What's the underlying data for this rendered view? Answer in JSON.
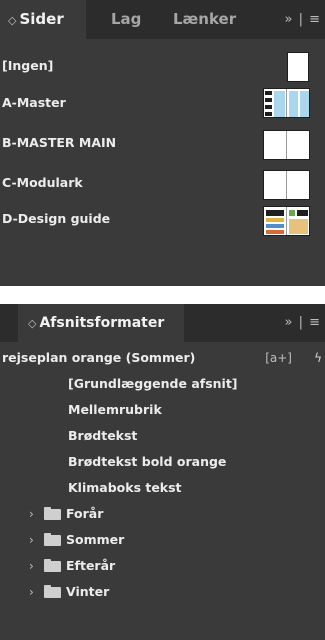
{
  "pages_panel": {
    "tabs": [
      {
        "label": "Sider",
        "active": true
      },
      {
        "label": "Lag",
        "active": false
      },
      {
        "label": "Lænker",
        "active": false
      }
    ],
    "overflow_glyph": "»",
    "menu_glyph": "|  ≡",
    "collapse_glyph": "◇",
    "masters": [
      {
        "label": "[Ingen]",
        "thumb": "single-blank"
      },
      {
        "label": "A-Master",
        "thumb": "spread-grid"
      },
      {
        "label": "B-MASTER MAIN",
        "thumb": "spread-blank"
      },
      {
        "label": "C-Modulark",
        "thumb": "spread-blank"
      },
      {
        "label": "D-Design guide",
        "thumb": "spread-design"
      }
    ]
  },
  "paragraph_panel": {
    "title": "Afsnitsformater",
    "collapse_glyph": "◇",
    "overflow_glyph": "»",
    "menu_glyph": "|  ≡",
    "current_style": "rejseplan orange (Sommer)",
    "new_style_glyph": "[a+]",
    "clear_overrides_glyph": "ϟ",
    "styles": [
      "[Grundlæggende afsnit]",
      "Mellemrubrik",
      "Brødtekst",
      "Brødtekst bold orange",
      "Klimaboks tekst"
    ],
    "folders": [
      "Forår",
      "Sommer",
      "Efterår",
      "Vinter"
    ],
    "folder_chevron": "›"
  },
  "colors": {
    "panel_bg": "#3a3a3a",
    "tabbar_bg": "#2c2c2c",
    "text": "#ececec",
    "thumb_blue": "#a9d8ee"
  }
}
